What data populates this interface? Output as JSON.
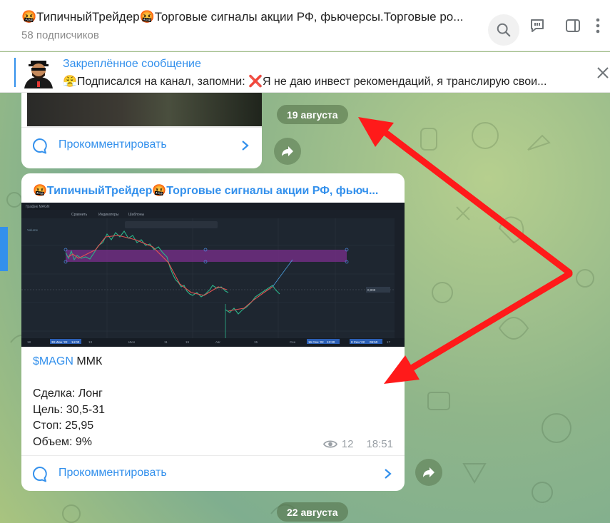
{
  "header": {
    "title": "🤬ТипичныйТрейдер🤬Торговые сигналы акции РФ, фьючерсы.Торговые ро...",
    "subscribers": "58 подписчиков"
  },
  "pinned": {
    "label": "Закреплённое сообщение",
    "text": "😤Подписался на канал, запомни: ❌Я не даю инвест рекомендаций, я транслирую свои..."
  },
  "dates": {
    "first": "19 августа",
    "second": "22 августа"
  },
  "card1": {
    "comment_label": "Прокомментировать"
  },
  "card2": {
    "channel": "🤬ТипичныйТрейдер🤬Торговые сигналы акции РФ, фьюч...",
    "ticker": "$MAGN",
    "ticker_name": " ММК",
    "line_deal": "Сделка: Лонг",
    "line_target": "Цель: 30,5-31",
    "line_stop": "Стоп: 25,95",
    "line_volume": "Объем: 9%",
    "views": "12",
    "time": "18:51",
    "comment_label": "Прокомментировать"
  },
  "chart_screenshot": {
    "window_title": "График MAGN",
    "toolbar": [
      "Сравнить",
      "Индикаторы",
      "Шаблоны"
    ],
    "volume_label": "Volume",
    "price_badge": "0,000",
    "x_labels": [
      "18",
      "30 Июн '22",
      "14:00",
      "13",
      "Июл",
      "11",
      "19",
      "Авг",
      "15",
      "Сен",
      "16 Сен '22",
      "13:30",
      "0 Сен '22",
      "09:50",
      "17"
    ]
  },
  "colors": {
    "accent": "#3390ec",
    "arrow": "#ff1a1a",
    "zone": "#7b2f8c"
  }
}
